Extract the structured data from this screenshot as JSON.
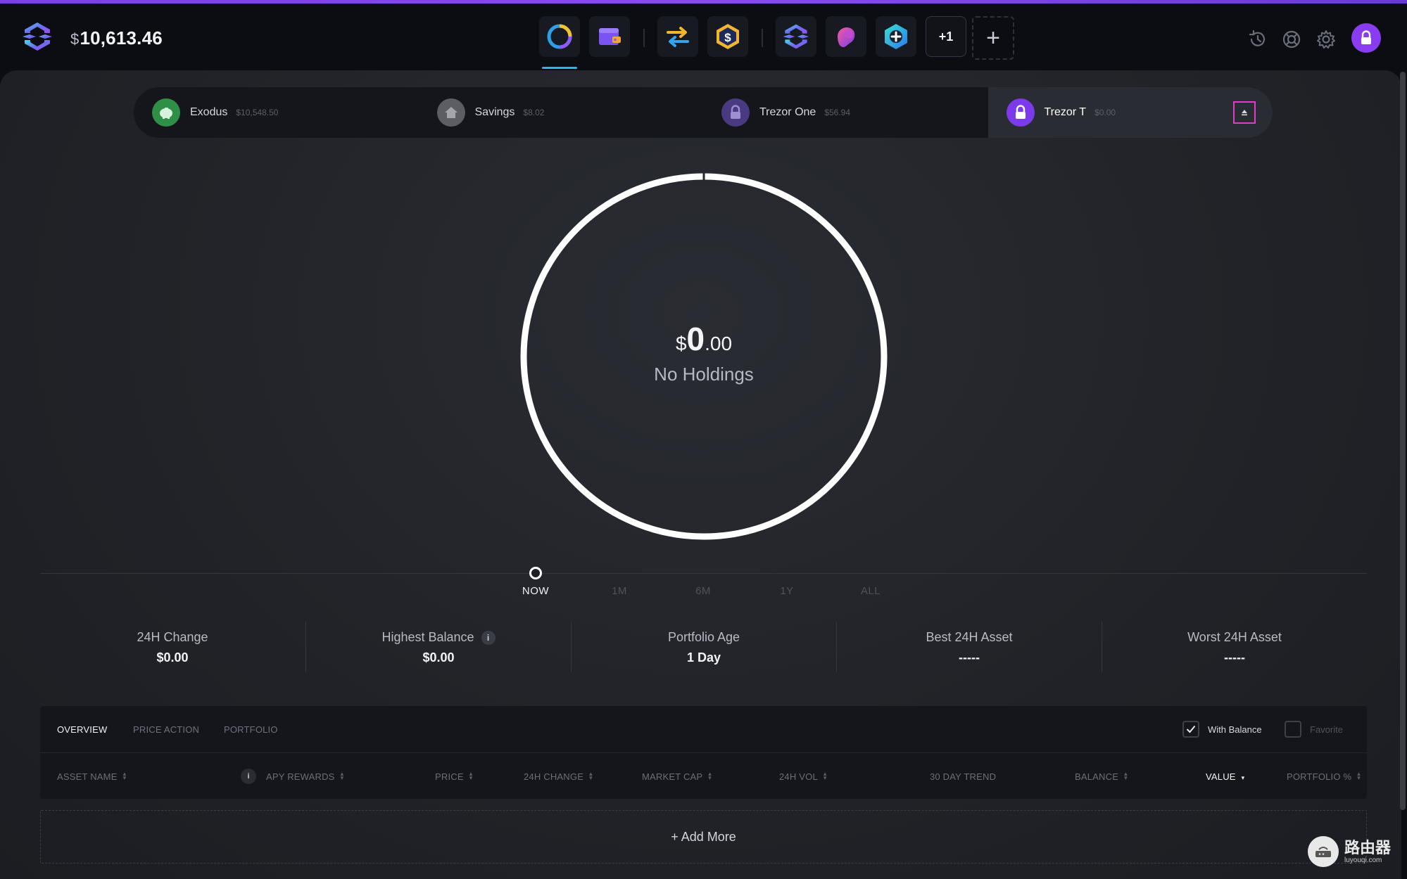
{
  "header": {
    "currency_symbol": "$",
    "total_balance": "10,613.46",
    "nav_icons": [
      "portfolio-icon",
      "wallet-icon",
      "exchange-icon",
      "stablecoin-icon",
      "exodus-app-icon",
      "spray-app-icon",
      "hex-add-app-icon"
    ],
    "more_apps_label": "+1",
    "add_app_label": "+",
    "right_icons": [
      "history-icon",
      "support-icon",
      "settings-icon",
      "lock-icon"
    ],
    "accent_color": "#8a3df0"
  },
  "wallets": [
    {
      "name": "Exodus",
      "balance": "$10,548.50",
      "color": "#2f8f46"
    },
    {
      "name": "Savings",
      "balance": "$8.02",
      "color": "#5d5e63"
    },
    {
      "name": "Trezor One",
      "balance": "$56.94",
      "color": "#4a3a82"
    },
    {
      "name": "Trezor T",
      "balance": "$0.00",
      "color": "#7c3bea",
      "active": true
    }
  ],
  "ring": {
    "currency": "$",
    "whole": "0",
    "cents": ".00",
    "label": "No Holdings"
  },
  "timeline": {
    "options": [
      "NOW",
      "1M",
      "6M",
      "1Y",
      "ALL"
    ],
    "selected": "NOW"
  },
  "stats": [
    {
      "title": "24H Change",
      "value": "$0.00"
    },
    {
      "title": "Highest Balance",
      "value": "$0.00",
      "info": "i"
    },
    {
      "title": "Portfolio Age",
      "value": "1 Day"
    },
    {
      "title": "Best 24H Asset",
      "value": "-----"
    },
    {
      "title": "Worst 24H Asset",
      "value": "-----"
    }
  ],
  "table": {
    "tabs": [
      "OVERVIEW",
      "PRICE ACTION",
      "PORTFOLIO"
    ],
    "active_tab": "OVERVIEW",
    "filters": [
      {
        "label": "With Balance",
        "checked": true
      },
      {
        "label": "Favorite",
        "checked": false
      }
    ],
    "info": "i",
    "columns": [
      "ASSET NAME",
      "APY REWARDS",
      "PRICE",
      "24H CHANGE",
      "MARKET CAP",
      "24H VOL",
      "30 DAY TREND",
      "BALANCE",
      "VALUE",
      "PORTFOLIO %"
    ],
    "sorted_column": "VALUE",
    "add_more": "+ Add More"
  },
  "watermark": {
    "cn": "路由器",
    "en": "luyouqi.com"
  }
}
